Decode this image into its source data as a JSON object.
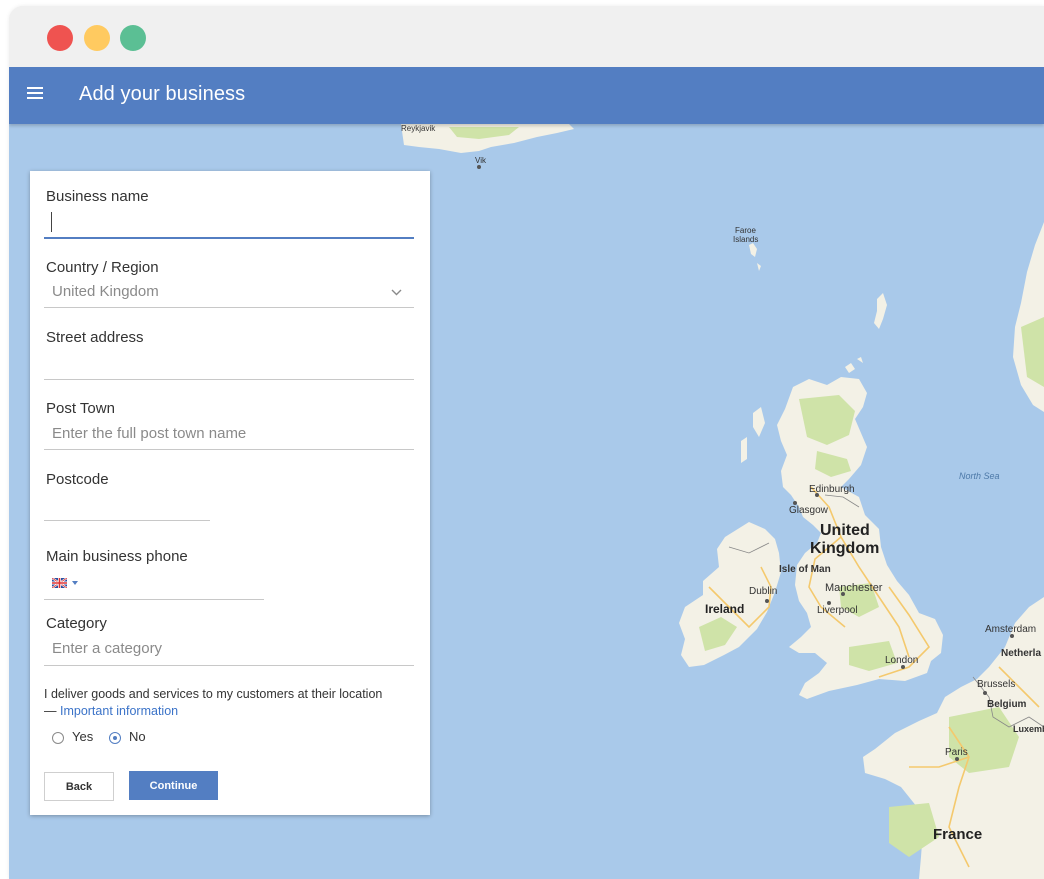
{
  "window": {
    "controls": [
      "close",
      "minimize",
      "maximize"
    ]
  },
  "appbar": {
    "title": "Add your business",
    "menu_icon": "hamburger-menu-icon"
  },
  "form": {
    "business_name": {
      "label": "Business name",
      "value": ""
    },
    "country": {
      "label": "Country / Region",
      "value": "United Kingdom"
    },
    "street": {
      "label": "Street address",
      "value": ""
    },
    "post_town": {
      "label": "Post Town",
      "placeholder": "Enter the full post town name"
    },
    "postcode": {
      "label": "Postcode",
      "value": ""
    },
    "phone": {
      "label": "Main business phone",
      "flag": "uk-flag-icon"
    },
    "category": {
      "label": "Category",
      "placeholder": "Enter a category"
    },
    "delivery": {
      "question": "I deliver goods and services to my customers at their location",
      "dash": "—",
      "link": "Important information",
      "yes_label": "Yes",
      "no_label": "No",
      "selected": "No"
    },
    "back_label": "Back",
    "continue_label": "Continue"
  },
  "map": {
    "labels": {
      "reykjavik": "Reykjavik",
      "vik": "Vik",
      "faroe_1": "Faroe",
      "faroe_2": "Islands",
      "north_sea": "North Sea",
      "edinburgh": "Edinburgh",
      "glasgow": "Glasgow",
      "uk_1": "United",
      "uk_2": "Kingdom",
      "isle_of_man": "Isle of Man",
      "manchester": "Manchester",
      "dublin": "Dublin",
      "ireland": "Ireland",
      "liverpool": "Liverpool",
      "london": "London",
      "amsterdam": "Amsterdam",
      "netherlands": "Netherla",
      "brussels": "Brussels",
      "belgium": "Belgium",
      "luxembourg": "Luxemb",
      "paris": "Paris",
      "france": "France"
    }
  },
  "colors": {
    "appbar": "#537ec2",
    "water": "#a9c9ea",
    "land": "#f3f1e6",
    "park": "#cfe3a8",
    "road": "#f4c96d",
    "accent": "#537ec2",
    "link": "#3b73c8",
    "close": "#ef5350",
    "minimize": "#ffca60",
    "maximize": "#5bbf94"
  }
}
